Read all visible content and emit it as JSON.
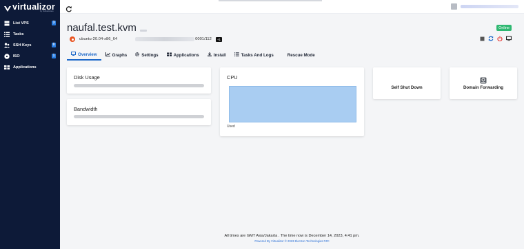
{
  "brand": {
    "name": "virtualizor",
    "sub": "by Softaculous"
  },
  "sidebar": {
    "items": [
      {
        "label": "List VPS",
        "icon": "server-icon",
        "badge": "3"
      },
      {
        "label": "Tasks",
        "icon": "list-icon",
        "badge": ""
      },
      {
        "label": "SSH Keys",
        "icon": "users-icon",
        "badge": "0"
      },
      {
        "label": "ISO",
        "icon": "disc-icon",
        "badge": "1"
      },
      {
        "label": "Applications",
        "icon": "apps-icon",
        "badge": ""
      }
    ]
  },
  "vps": {
    "hostname": "naufal.test.kvm",
    "status": "Online",
    "os": "ubuntu-20.04-x86_64",
    "ip_suffix": "0001/112",
    "extra_ips": "+1"
  },
  "tabs": [
    {
      "label": "Overview",
      "icon": "monitor-icon",
      "active": true
    },
    {
      "label": "Graphs",
      "icon": "chart-icon"
    },
    {
      "label": "Settings",
      "icon": "gear-icon"
    },
    {
      "label": "Applications",
      "icon": "apps-icon"
    },
    {
      "label": "Install",
      "icon": "download-icon"
    },
    {
      "label": "Tasks And Logs",
      "icon": "list-icon"
    },
    {
      "label": "Rescue Mode",
      "icon": ""
    }
  ],
  "cards": {
    "disk": {
      "title": "Disk Usage"
    },
    "bandwidth": {
      "title": "Bandwidth"
    },
    "cpu": {
      "title": "CPU",
      "used_label": "Used"
    },
    "shutdown": {
      "label": "Self Shut Down"
    },
    "domain": {
      "label": "Domain Forwarding"
    }
  },
  "footer": {
    "line1": "All times are GMT Asia/Jakarta . The time now is December 14, 2023, 4:41 pm.",
    "line2": "Powered By Virtualizor © 2023 Electron Technologies FZC"
  },
  "colors": {
    "sidebar": "#0d1a38",
    "accent": "#1b67c9",
    "online": "#2fb872",
    "power": "#e53935"
  }
}
